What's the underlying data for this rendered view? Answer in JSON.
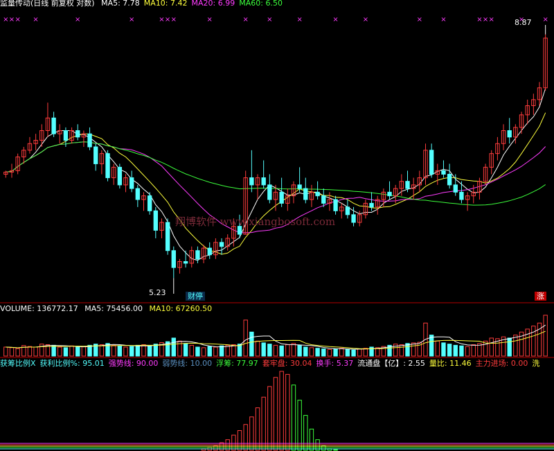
{
  "colors": {
    "up": "#ff3c3c",
    "down": "#54ffff",
    "ma5": "#ffffff",
    "ma10": "#ffff3c",
    "ma20": "#ff3cff",
    "ma60": "#3cff3c",
    "xmark": "#ff3cff",
    "divider": "#b40000",
    "watermark": "#7a2a38"
  },
  "price_panel": {
    "title": "监量传动(日线 前复权 对数)",
    "ma_values": [
      {
        "label": "MA5: 7.78",
        "color": "#ffffff"
      },
      {
        "label": "MA10: 7.42",
        "color": "#ffff3c"
      },
      {
        "label": "MA20: 6.99",
        "color": "#ff3cff"
      },
      {
        "label": "MA60: 6.50",
        "color": "#3cff3c"
      }
    ],
    "high_label": "8.87",
    "low_label": "5.23",
    "event_badge": "财停",
    "limit_badge": "涨",
    "watermark": "翔博软件 www.xiangbosoft.com"
  },
  "volume_panel": {
    "title": "VOLUME: 136772.17",
    "ma5": "MA5: 75456.00",
    "ma10": "MA10: 67260.50"
  },
  "indicator_panel": {
    "items": [
      {
        "label": "获筹比例X",
        "color": "#54ffff"
      },
      {
        "label": "获利比例%: 95.01",
        "color": "#54ffff"
      },
      {
        "label": "强势线: 90.00",
        "color": "#ff3cff"
      },
      {
        "label": "弱势线: 10.00",
        "color": "#5a8fbf"
      },
      {
        "label": "浮筹: 77.97",
        "color": "#3cff3c"
      },
      {
        "label": "套牢盘: 30.04",
        "color": "#ff3c3c"
      },
      {
        "label": "换手: 5.37",
        "color": "#ff3cff"
      },
      {
        "label": "流通盘【亿】: 2.55",
        "color": "#ffffff"
      },
      {
        "label": "量比: 11.46",
        "color": "#ffff3c"
      },
      {
        "label": "主力进场: 0.00",
        "color": "#ff3c3c"
      },
      {
        "label": "洗",
        "color": "#ffff3c"
      }
    ]
  },
  "chart_data": {
    "type": "candlestick",
    "scale": "log",
    "series_names": [
      "MA5",
      "MA10",
      "MA20",
      "MA60"
    ],
    "x_marks_rows": [
      "× × ×",
      "×",
      "× ×"
    ],
    "candles": [
      [
        6.55,
        6.6,
        6.5,
        6.58
      ],
      [
        6.58,
        6.7,
        6.5,
        6.6
      ],
      [
        6.6,
        6.85,
        6.55,
        6.8
      ],
      [
        6.8,
        6.95,
        6.7,
        6.9
      ],
      [
        6.9,
        7.1,
        6.85,
        7.0
      ],
      [
        7.0,
        7.15,
        6.9,
        7.05
      ],
      [
        7.05,
        7.3,
        6.95,
        7.2
      ],
      [
        7.2,
        7.65,
        7.1,
        7.4
      ],
      [
        7.4,
        7.5,
        7.1,
        7.15
      ],
      [
        7.15,
        7.3,
        7.0,
        7.2
      ],
      [
        7.2,
        7.25,
        6.95,
        7.05
      ],
      [
        7.05,
        7.25,
        7.0,
        7.2
      ],
      [
        7.2,
        7.3,
        7.05,
        7.1
      ],
      [
        7.1,
        7.2,
        6.95,
        7.15
      ],
      [
        7.15,
        7.25,
        6.9,
        6.95
      ],
      [
        6.95,
        7.0,
        6.6,
        6.7
      ],
      [
        6.7,
        6.9,
        6.55,
        6.85
      ],
      [
        6.85,
        6.9,
        6.45,
        6.5
      ],
      [
        6.5,
        6.7,
        6.4,
        6.65
      ],
      [
        6.65,
        6.7,
        6.35,
        6.4
      ],
      [
        6.4,
        6.55,
        6.3,
        6.5
      ],
      [
        6.5,
        6.6,
        6.3,
        6.35
      ],
      [
        6.35,
        6.4,
        6.1,
        6.2
      ],
      [
        6.2,
        6.3,
        6.05,
        6.25
      ],
      [
        6.25,
        6.3,
        6.0,
        6.05
      ],
      [
        6.05,
        6.1,
        5.7,
        5.8
      ],
      [
        5.8,
        5.95,
        5.7,
        5.9
      ],
      [
        5.9,
        5.95,
        5.5,
        5.55
      ],
      [
        5.55,
        5.6,
        5.23,
        5.35
      ],
      [
        5.35,
        5.45,
        5.28,
        5.42
      ],
      [
        5.42,
        5.55,
        5.35,
        5.4
      ],
      [
        5.4,
        5.6,
        5.35,
        5.55
      ],
      [
        5.55,
        5.6,
        5.4,
        5.45
      ],
      [
        5.45,
        5.62,
        5.4,
        5.58
      ],
      [
        5.58,
        5.65,
        5.45,
        5.5
      ],
      [
        5.5,
        5.7,
        5.45,
        5.65
      ],
      [
        5.65,
        5.7,
        5.5,
        5.6
      ],
      [
        5.6,
        5.75,
        5.55,
        5.7
      ],
      [
        5.7,
        5.95,
        5.6,
        5.85
      ],
      [
        5.85,
        6.0,
        5.7,
        5.75
      ],
      [
        5.75,
        6.6,
        5.75,
        6.5
      ],
      [
        6.5,
        6.9,
        6.3,
        6.4
      ],
      [
        6.4,
        6.55,
        6.2,
        6.5
      ],
      [
        6.5,
        6.75,
        6.35,
        6.4
      ],
      [
        6.4,
        6.55,
        6.15,
        6.2
      ],
      [
        6.2,
        6.4,
        6.05,
        6.3
      ],
      [
        6.3,
        6.5,
        6.1,
        6.15
      ],
      [
        6.15,
        6.35,
        6.05,
        6.25
      ],
      [
        6.25,
        6.45,
        6.15,
        6.4
      ],
      [
        6.4,
        6.65,
        6.3,
        6.35
      ],
      [
        6.35,
        6.5,
        6.15,
        6.2
      ],
      [
        6.2,
        6.4,
        6.1,
        6.3
      ],
      [
        6.3,
        6.45,
        6.2,
        6.25
      ],
      [
        6.25,
        6.35,
        6.1,
        6.15
      ],
      [
        6.15,
        6.3,
        6.05,
        6.2
      ],
      [
        6.2,
        6.25,
        6.0,
        6.05
      ],
      [
        6.05,
        6.15,
        5.95,
        6.1
      ],
      [
        6.1,
        6.2,
        5.95,
        6.0
      ],
      [
        6.0,
        6.1,
        5.85,
        5.9
      ],
      [
        5.9,
        6.05,
        5.85,
        6.0
      ],
      [
        6.0,
        6.2,
        5.95,
        6.15
      ],
      [
        6.15,
        6.3,
        6.05,
        6.1
      ],
      [
        6.1,
        6.25,
        6.0,
        6.2
      ],
      [
        6.2,
        6.35,
        6.1,
        6.3
      ],
      [
        6.3,
        6.45,
        6.2,
        6.25
      ],
      [
        6.25,
        6.4,
        6.15,
        6.35
      ],
      [
        6.35,
        6.55,
        6.25,
        6.45
      ],
      [
        6.45,
        6.6,
        6.3,
        6.35
      ],
      [
        6.35,
        6.5,
        6.2,
        6.4
      ],
      [
        6.4,
        6.6,
        6.3,
        6.5
      ],
      [
        6.5,
        7.0,
        6.4,
        6.9
      ],
      [
        6.9,
        7.0,
        6.5,
        6.55
      ],
      [
        6.55,
        6.7,
        6.4,
        6.6
      ],
      [
        6.6,
        6.75,
        6.5,
        6.55
      ],
      [
        6.55,
        6.7,
        6.35,
        6.4
      ],
      [
        6.4,
        6.55,
        6.25,
        6.3
      ],
      [
        6.3,
        6.45,
        6.15,
        6.2
      ],
      [
        6.2,
        6.3,
        6.05,
        6.25
      ],
      [
        6.25,
        6.4,
        6.15,
        6.3
      ],
      [
        6.3,
        6.5,
        6.2,
        6.45
      ],
      [
        6.45,
        6.7,
        6.4,
        6.65
      ],
      [
        6.65,
        6.9,
        6.55,
        6.85
      ],
      [
        6.85,
        7.1,
        6.75,
        7.0
      ],
      [
        7.0,
        7.3,
        6.9,
        7.2
      ],
      [
        7.2,
        7.4,
        7.0,
        7.1
      ],
      [
        7.1,
        7.3,
        7.0,
        7.25
      ],
      [
        7.25,
        7.5,
        7.15,
        7.45
      ],
      [
        7.45,
        7.7,
        7.3,
        7.6
      ],
      [
        7.6,
        7.8,
        7.45,
        7.7
      ],
      [
        7.7,
        8.0,
        7.6,
        7.9
      ],
      [
        7.9,
        8.87,
        7.85,
        8.8
      ]
    ],
    "volume": [
      30,
      28,
      25,
      35,
      32,
      30,
      40,
      38,
      36,
      30,
      28,
      34,
      30,
      32,
      36,
      40,
      38,
      42,
      36,
      34,
      30,
      32,
      36,
      38,
      34,
      40,
      45,
      48,
      60,
      50,
      42,
      36,
      30,
      28,
      32,
      30,
      34,
      36,
      38,
      40,
      120,
      80,
      50,
      44,
      40,
      36,
      34,
      38,
      42,
      36,
      30,
      28,
      26,
      24,
      22,
      24,
      26,
      22,
      20,
      24,
      26,
      30,
      28,
      32,
      36,
      40,
      38,
      42,
      44,
      46,
      110,
      70,
      50,
      44,
      40,
      36,
      34,
      32,
      38,
      42,
      50,
      60,
      58,
      64,
      60,
      70,
      80,
      90,
      100,
      110,
      136
    ],
    "chip_profile": [
      0,
      0,
      0,
      0,
      0,
      0,
      0,
      0,
      0,
      0,
      0,
      0,
      0,
      0,
      0,
      0,
      0,
      0,
      0,
      0,
      0,
      0,
      0,
      0,
      0,
      0,
      0,
      0,
      0,
      0,
      0,
      0,
      0,
      2,
      4,
      6,
      10,
      14,
      20,
      26,
      34,
      44,
      56,
      70,
      84,
      96,
      104,
      100,
      86,
      66,
      46,
      28,
      14,
      6,
      2,
      1,
      0,
      0,
      0,
      0,
      0,
      0,
      0,
      0,
      0,
      0,
      0,
      0,
      0,
      0,
      0,
      0,
      0,
      0,
      0,
      0,
      0,
      0,
      0,
      0,
      0,
      0,
      0,
      0,
      0,
      0,
      0,
      0,
      0,
      0,
      0
    ]
  }
}
